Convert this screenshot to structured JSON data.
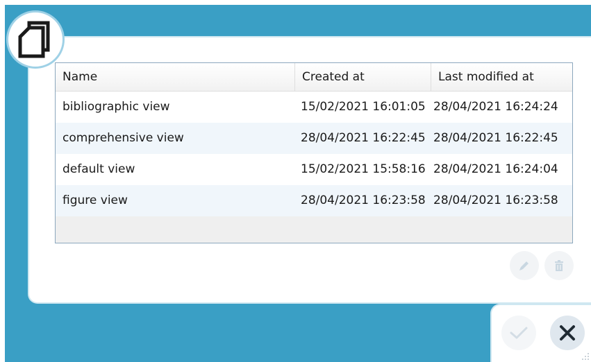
{
  "table": {
    "columns": {
      "name": "Name",
      "created": "Created at",
      "modified": "Last modified at"
    },
    "rows": [
      {
        "name": "bibliographic view",
        "created": "15/02/2021 16:01:05",
        "modified": "28/04/2021 16:24:24"
      },
      {
        "name": "comprehensive view",
        "created": "28/04/2021 16:22:45",
        "modified": "28/04/2021 16:22:45"
      },
      {
        "name": "default view",
        "created": "15/02/2021 15:58:16",
        "modified": "28/04/2021 16:24:04"
      },
      {
        "name": "figure view",
        "created": "28/04/2021 16:23:58",
        "modified": "28/04/2021 16:23:58"
      }
    ]
  },
  "icons": {
    "app_badge": "documents-icon",
    "edit": "pencil-icon",
    "delete": "trash-icon",
    "confirm": "checkmark-icon",
    "close": "close-icon",
    "resize": "resize-grip-icon"
  },
  "colors": {
    "backdrop": "#3a9fc5",
    "badge_ring": "#9fd1e6",
    "table_border": "#8ba7bd",
    "row_alt": "#f0f6fb",
    "disabled_icon": "#c9d7e1",
    "close_icon": "#1f2a33"
  }
}
